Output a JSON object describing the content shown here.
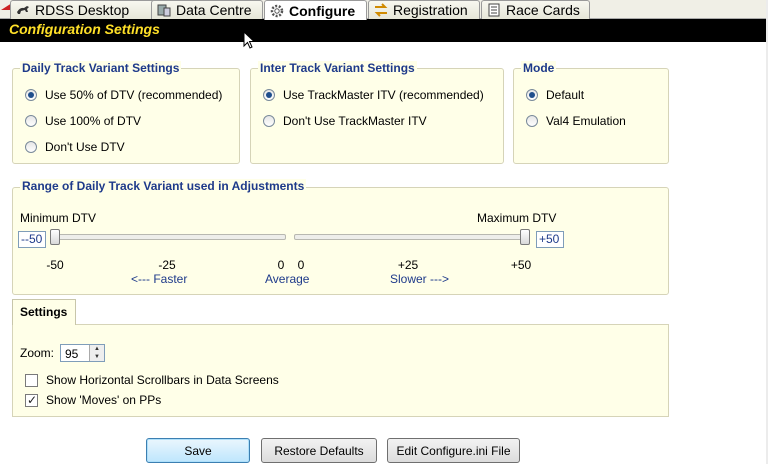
{
  "tabs": [
    {
      "label": "RDSS Desktop",
      "icon": "racehorse-icon",
      "active": false
    },
    {
      "label": "Data Centre",
      "icon": "database-icon",
      "active": false
    },
    {
      "label": "Configure",
      "icon": "gear-icon",
      "active": true
    },
    {
      "label": "Registration",
      "icon": "exchange-arrows-icon",
      "active": false
    },
    {
      "label": "Race Cards",
      "icon": "cards-icon",
      "active": false
    }
  ],
  "title": "Configuration Settings",
  "daily_track": {
    "title": "Daily Track Variant Settings",
    "options": [
      {
        "label": "Use 50% of DTV (recommended)",
        "checked": true
      },
      {
        "label": "Use 100% of DTV",
        "checked": false
      },
      {
        "label": "Don't Use DTV",
        "checked": false
      }
    ]
  },
  "inter_track": {
    "title": "Inter Track Variant Settings",
    "options": [
      {
        "label": "Use TrackMaster ITV (recommended)",
        "checked": true
      },
      {
        "label": "Don't Use TrackMaster ITV",
        "checked": false
      }
    ]
  },
  "mode": {
    "title": "Mode",
    "options": [
      {
        "label": "Default",
        "checked": true
      },
      {
        "label": "Val4 Emulation",
        "checked": false
      }
    ]
  },
  "range": {
    "title": "Range of Daily Track Variant used in Adjustments",
    "min_label": "Minimum DTV",
    "max_label": "Maximum DTV",
    "min_value": "--50",
    "max_value": "+50",
    "min_ticks": [
      "-50",
      "-25",
      "0"
    ],
    "max_ticks": [
      "0",
      "+25",
      "+50"
    ],
    "faster": "<--- Faster",
    "average": "Average",
    "slower": "Slower --->",
    "min_slider_value": -50,
    "max_slider_value": 50
  },
  "settings": {
    "tab_label": "Settings",
    "zoom_label": "Zoom:",
    "zoom_value": "95",
    "checks": [
      {
        "label": "Show Horizontal Scrollbars in Data Screens",
        "checked": false
      },
      {
        "label": "Show 'Moves' on PPs",
        "checked": true
      }
    ]
  },
  "buttons": {
    "save": "Save",
    "restore": "Restore Defaults",
    "edit": "Edit Configure.ini File"
  }
}
